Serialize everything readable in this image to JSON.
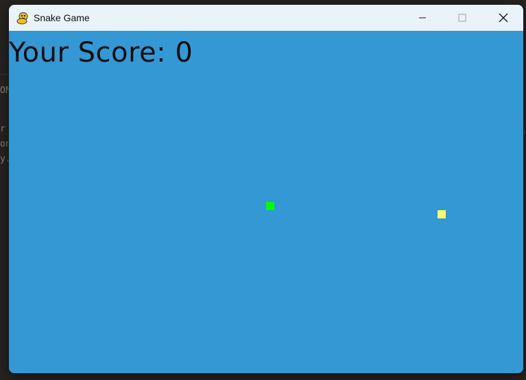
{
  "window": {
    "title": "Snake Game",
    "app_icon": "pygame-snake-icon",
    "controls": [
      "minimize-icon",
      "maximize-icon",
      "close-icon"
    ]
  },
  "background": {
    "code_fragments": [
      "ON",
      "r =",
      "on",
      "y."
    ]
  },
  "game": {
    "score_label": "Your Score: 0",
    "score_value": 0,
    "colors": {
      "background": "#3398d4",
      "snake": "#00ff00",
      "food": "#ffff66",
      "text": "#0d0d0d"
    }
  }
}
